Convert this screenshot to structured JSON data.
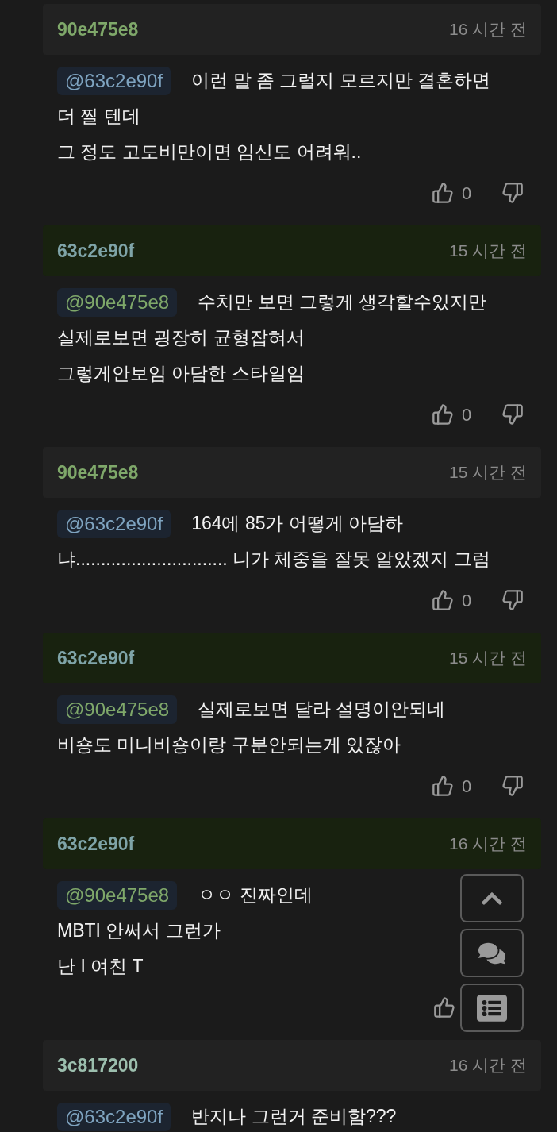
{
  "comments": [
    {
      "author": "90e475e8",
      "color": "#7fa86a",
      "highlighted": false,
      "time": "16 시간 전",
      "mention": {
        "text": "@63c2e90f",
        "color": "#7fa4c0"
      },
      "lines": [
        "이런 말 좀 그럴지 모르지만 결혼하면",
        "더 찔 텐데",
        "그 정도 고도비만이면 임신도 어려워.."
      ],
      "votes": "0"
    },
    {
      "author": "63c2e90f",
      "color": "#7fa4a8",
      "highlighted": true,
      "time": "15 시간 전",
      "mention": {
        "text": "@90e475e8",
        "color": "#7fa86a"
      },
      "lines": [
        "수치만 보면 그렇게 생각할수있지만",
        "실제로보면 굉장히 균형잡혀서",
        "그렇게안보임 아담한 스타일임"
      ],
      "votes": "0"
    },
    {
      "author": "90e475e8",
      "color": "#7fa86a",
      "highlighted": false,
      "time": "15 시간 전",
      "mention": {
        "text": "@63c2e90f",
        "color": "#7fa4c0"
      },
      "lines": [
        "164에 85가 어떻게 아담하",
        "냐.............................. 니가 체중을 잘못 알았겠지 그럼"
      ],
      "votes": "0"
    },
    {
      "author": "63c2e90f",
      "color": "#7fa4a8",
      "highlighted": true,
      "time": "15 시간 전",
      "mention": {
        "text": "@90e475e8",
        "color": "#7fa86a"
      },
      "lines": [
        "실제로보면 달라 설명이안되네",
        "비숑도 미니비숑이랑 구분안되는게 있잖아"
      ],
      "votes": "0"
    },
    {
      "author": "63c2e90f",
      "color": "#7fa4a8",
      "highlighted": true,
      "time": "16 시간 전",
      "mention": {
        "text": "@90e475e8",
        "color": "#7fa86a"
      },
      "lines": [
        "ㅇㅇ 진짜인데",
        "MBTI 안써서 그런가",
        "난 I 여친 T"
      ]
    },
    {
      "author": "3c817200",
      "color": "#9cbfae",
      "highlighted": false,
      "time": "16 시간 전",
      "mention": {
        "text": "@63c2e90f",
        "color": "#7fa4c0"
      },
      "lines": [
        "반지나 그런거 준비함???"
      ]
    }
  ],
  "floating_buttons": [
    {
      "kind": "top"
    },
    {
      "kind": "comments"
    },
    {
      "kind": "list"
    }
  ]
}
